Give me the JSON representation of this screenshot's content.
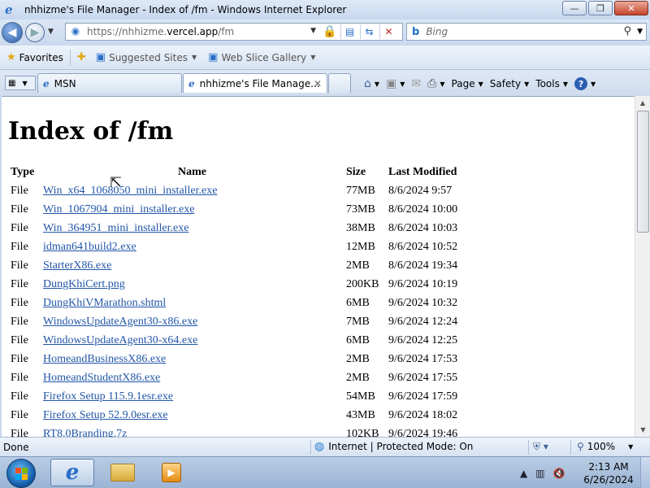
{
  "window": {
    "title": "nhhizme's File Manager - Index of /fm - Windows Internet Explorer",
    "min_label": "—",
    "max_label": "❐",
    "close_label": "✕"
  },
  "address": {
    "url_prefix": "https://nhhizme.",
    "url_domain": "vercel.app",
    "url_path": "/fm"
  },
  "search": {
    "placeholder": "Bing",
    "engine_icon": "bing-icon"
  },
  "favorites_bar": {
    "favorites_label": "Favorites",
    "items": [
      {
        "label": "Suggested Sites"
      },
      {
        "label": "Web Slice Gallery"
      }
    ]
  },
  "tabs": [
    {
      "label": "MSN",
      "active": false
    },
    {
      "label": "nhhizme's File Manage...",
      "active": true
    }
  ],
  "command_bar": {
    "page_label": "Page",
    "safety_label": "Safety",
    "tools_label": "Tools",
    "help_label": "?"
  },
  "page": {
    "heading": "Index of /fm",
    "columns": [
      "Type",
      "Name",
      "Size",
      "Last Modified"
    ],
    "rows": [
      {
        "type": "File",
        "name": "Win_x64_1068050_mini_installer.exe",
        "size": "77MB",
        "modified": "8/6/2024 9:57"
      },
      {
        "type": "File",
        "name": "Win_1067904_mini_installer.exe",
        "size": "73MB",
        "modified": "8/6/2024 10:00"
      },
      {
        "type": "File",
        "name": "Win_364951_mini_installer.exe",
        "size": "38MB",
        "modified": "8/6/2024 10:03"
      },
      {
        "type": "File",
        "name": "idman641build2.exe",
        "size": "12MB",
        "modified": "8/6/2024 10:52"
      },
      {
        "type": "File",
        "name": "StarterX86.exe",
        "size": "2MB",
        "modified": "8/6/2024 19:34"
      },
      {
        "type": "File",
        "name": "DungKhiCert.png",
        "size": "200KB",
        "modified": "9/6/2024 10:19"
      },
      {
        "type": "File",
        "name": "DungKhiVMarathon.shtml",
        "size": "6MB",
        "modified": "9/6/2024 10:32"
      },
      {
        "type": "File",
        "name": "WindowsUpdateAgent30-x86.exe",
        "size": "7MB",
        "modified": "9/6/2024 12:24"
      },
      {
        "type": "File",
        "name": "WindowsUpdateAgent30-x64.exe",
        "size": "6MB",
        "modified": "9/6/2024 12:25"
      },
      {
        "type": "File",
        "name": "HomeandBusinessX86.exe",
        "size": "2MB",
        "modified": "9/6/2024 17:53"
      },
      {
        "type": "File",
        "name": "HomeandStudentX86.exe",
        "size": "2MB",
        "modified": "9/6/2024 17:55"
      },
      {
        "type": "File",
        "name": "Firefox Setup 115.9.1esr.exe",
        "size": "54MB",
        "modified": "9/6/2024 17:59"
      },
      {
        "type": "File",
        "name": "Firefox Setup 52.9.0esr.exe",
        "size": "43MB",
        "modified": "9/6/2024 18:02"
      },
      {
        "type": "File",
        "name": "RT8.0Branding.7z",
        "size": "102KB",
        "modified": "9/6/2024 19:46"
      }
    ]
  },
  "statusbar": {
    "status": "Done",
    "zone": "Internet | Protected Mode: On",
    "zoom": "100%"
  },
  "taskbar": {
    "apps": [
      "internet-explorer",
      "windows-explorer",
      "windows-media-player"
    ],
    "clock_time": "2:13 AM",
    "clock_date": "6/26/2024"
  }
}
